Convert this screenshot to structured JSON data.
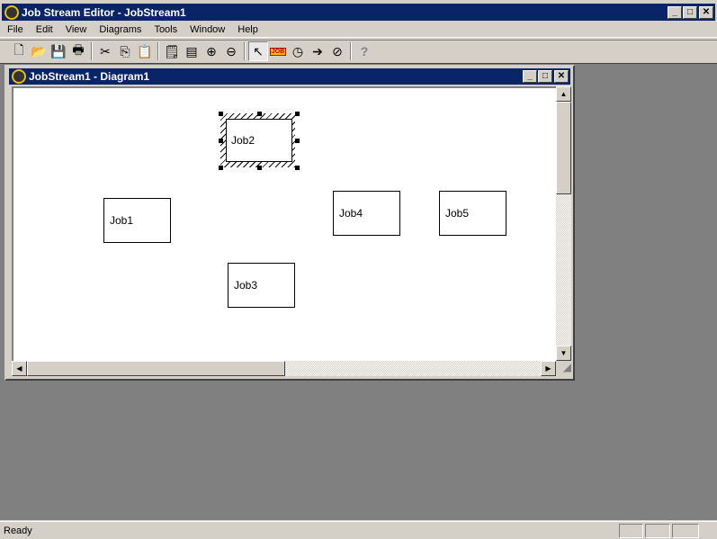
{
  "app": {
    "title": "Job Stream Editor - JobStream1"
  },
  "menu": [
    "File",
    "Edit",
    "View",
    "Diagrams",
    "Tools",
    "Window",
    "Help"
  ],
  "toolbar": [
    {
      "icon": "new-icon",
      "glyph": "🗋"
    },
    {
      "icon": "open-icon",
      "glyph": "📂"
    },
    {
      "icon": "save-icon",
      "glyph": "💾"
    },
    {
      "icon": "print-icon",
      "glyph": "🖶"
    },
    {
      "sep": true
    },
    {
      "icon": "cut-icon",
      "glyph": "✂"
    },
    {
      "icon": "copy-icon",
      "glyph": "⎘"
    },
    {
      "icon": "paste-icon",
      "glyph": "📋"
    },
    {
      "sep": true
    },
    {
      "icon": "properties-icon",
      "glyph": "🗒"
    },
    {
      "icon": "details-icon",
      "glyph": "▤"
    },
    {
      "icon": "zoom-in-icon",
      "glyph": "⊕"
    },
    {
      "icon": "zoom-out-icon",
      "glyph": "⊖"
    },
    {
      "sep": true
    },
    {
      "icon": "pointer-icon",
      "glyph": "↖",
      "pressed": true
    },
    {
      "icon": "job-icon",
      "glyph": "JOB"
    },
    {
      "icon": "clock-icon",
      "glyph": "◷"
    },
    {
      "icon": "arrow-icon",
      "glyph": "➔"
    },
    {
      "icon": "no-icon",
      "glyph": "⊘"
    },
    {
      "sep": true
    },
    {
      "icon": "help-icon",
      "glyph": "?"
    }
  ],
  "child": {
    "title": "JobStream1 - Diagram1"
  },
  "jobs": [
    {
      "label": "Job1"
    },
    {
      "label": "Job2",
      "selected": true
    },
    {
      "label": "Job3"
    },
    {
      "label": "Job4"
    },
    {
      "label": "Job5"
    }
  ],
  "status": {
    "text": "Ready"
  }
}
